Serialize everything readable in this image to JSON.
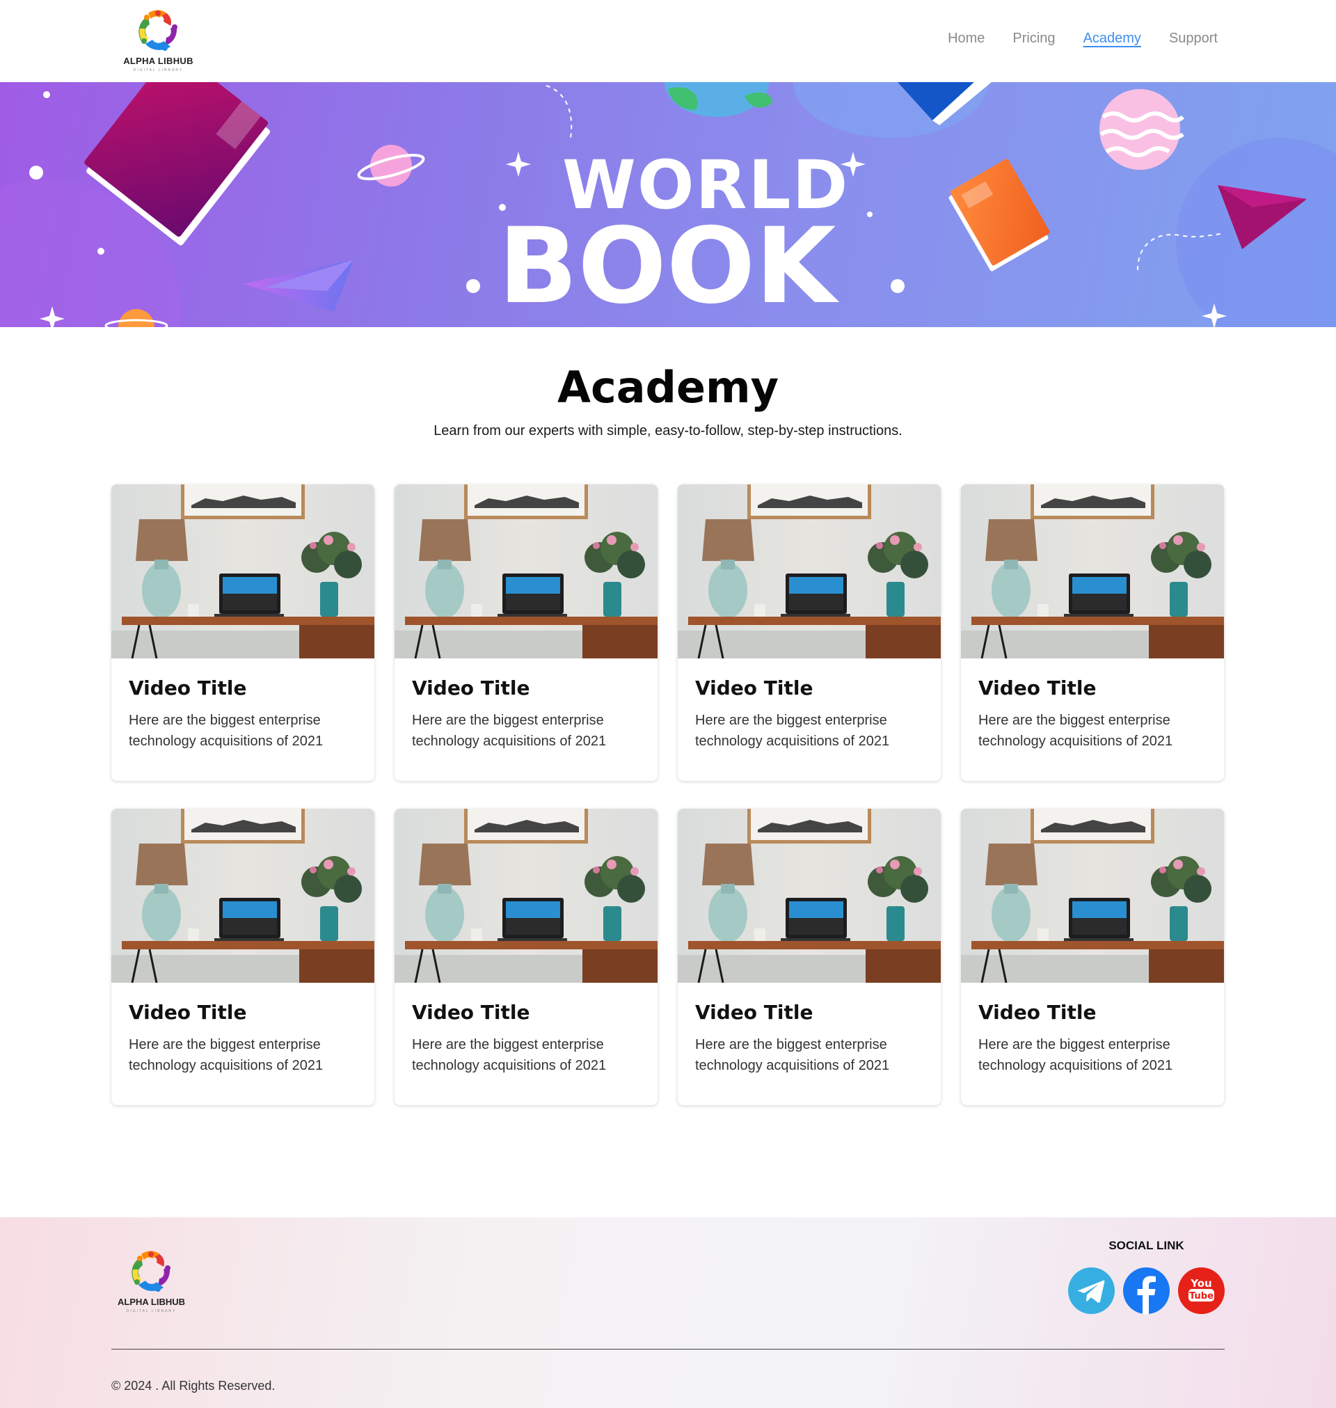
{
  "header": {
    "logo_text": "ALPHA LIBHUB",
    "logo_subtext": "DIGITAL LIBRARY",
    "nav": [
      {
        "label": "Home",
        "active": false
      },
      {
        "label": "Pricing",
        "active": false
      },
      {
        "label": "Academy",
        "active": true
      },
      {
        "label": "Support",
        "active": false
      }
    ]
  },
  "banner": {
    "line1": "WORLD",
    "line2": "BOOK"
  },
  "main": {
    "title": "Academy",
    "subtitle": "Learn from our experts with simple, easy-to-follow, step-by-step instructions.",
    "cards": [
      {
        "title": "Video Title",
        "description": "Here are the biggest enterprise technology acquisitions of 2021"
      },
      {
        "title": "Video Title",
        "description": "Here are the biggest enterprise technology acquisitions of 2021"
      },
      {
        "title": "Video Title",
        "description": "Here are the biggest enterprise technology acquisitions of 2021"
      },
      {
        "title": "Video Title",
        "description": "Here are the biggest enterprise technology acquisitions of 2021"
      },
      {
        "title": "Video Title",
        "description": "Here are the biggest enterprise technology acquisitions of 2021"
      },
      {
        "title": "Video Title",
        "description": "Here are the biggest enterprise technology acquisitions of 2021"
      },
      {
        "title": "Video Title",
        "description": "Here are the biggest enterprise technology acquisitions of 2021"
      },
      {
        "title": "Video Title",
        "description": "Here are the biggest enterprise technology acquisitions of 2021"
      }
    ]
  },
  "footer": {
    "logo_text": "ALPHA LIBHUB",
    "logo_subtext": "DIGITAL LIBRARY",
    "social_title": "SOCIAL LINK",
    "socials": [
      {
        "icon": "telegram-icon",
        "color": "#37aee2"
      },
      {
        "icon": "facebook-icon",
        "color": "#1877f2"
      },
      {
        "icon": "youtube-icon",
        "color": "#e62117"
      }
    ],
    "copyright": "© 2024 . All Rights Reserved."
  },
  "colors": {
    "accent": "#3d8ef0",
    "nav_text": "#8a8a8a"
  }
}
